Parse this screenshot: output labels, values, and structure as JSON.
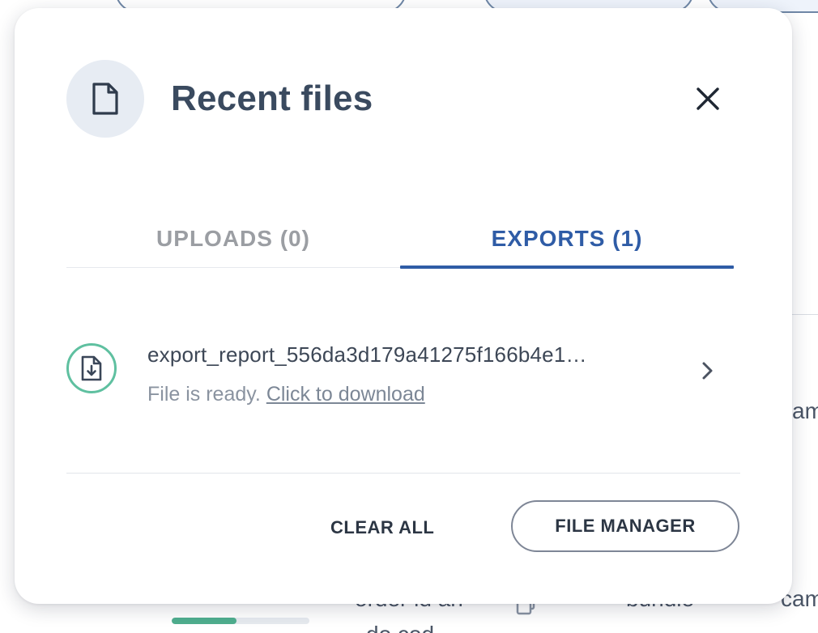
{
  "background": {
    "snippets": [
      {
        "id": "am",
        "text": "am"
      },
      {
        "id": "order",
        "text": "order id an"
      },
      {
        "id": "bundle",
        "text": "bundle"
      },
      {
        "id": "cam",
        "text": "cam"
      },
      {
        "id": "below",
        "text": "do cod"
      }
    ],
    "progress": {
      "value": 0.47
    }
  },
  "modal": {
    "title": "Recent files",
    "header_icon": "file-icon",
    "close_icon": "close-icon",
    "tabs": [
      {
        "label": "UPLOADS (0)",
        "active": false
      },
      {
        "label": "EXPORTS (1)",
        "active": true
      }
    ],
    "files": [
      {
        "name": "export_report_556da3d179a41275f166b4e1…",
        "status_text": "File is ready.",
        "link_text": "Click to download",
        "icon": "file-download-icon",
        "action_icon": "chevron-right-icon"
      }
    ],
    "footer": {
      "clear_label": "CLEAR ALL",
      "manager_label": "FILE MANAGER"
    }
  },
  "colors": {
    "accent": "#2f5ca6",
    "success": "#5fc0a0",
    "title": "#3a4a5f"
  }
}
